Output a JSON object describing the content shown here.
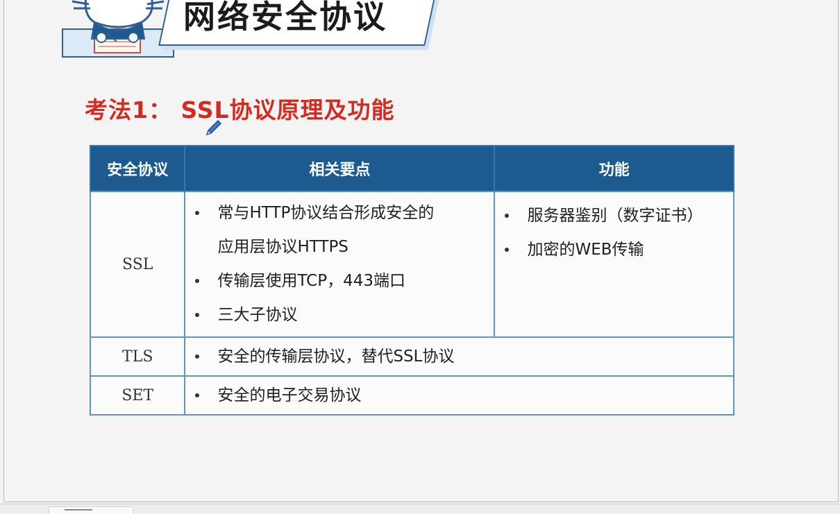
{
  "header": {
    "title": "网络安全协议"
  },
  "section": {
    "heading": "考法1： SSL协议原理及功能"
  },
  "table": {
    "columns": [
      "安全协议",
      "相关要点",
      "功能"
    ],
    "rows": {
      "ssl": {
        "name": "SSL",
        "points": [
          "常与HTTP协议结合形成安全的",
          "应用层协议HTTPS",
          "传输层使用TCP，443端口",
          "三大子协议"
        ],
        "functions": [
          "服务器鉴别（数字证书）",
          "加密的WEB传输"
        ]
      },
      "tls": {
        "name": "TLS",
        "point": "安全的传输层协议，替代SSL协议"
      },
      "set": {
        "name": "SET",
        "point": "安全的电子交易协议"
      }
    }
  },
  "colors": {
    "header_bg": "#1d5a8f",
    "border": "#5c95c9",
    "heading_red": "#d42a1f",
    "banner_border": "#2f5f94"
  },
  "icons": {
    "mascot": "cat-writing-mascot",
    "pen": "pen-cursor-icon"
  }
}
